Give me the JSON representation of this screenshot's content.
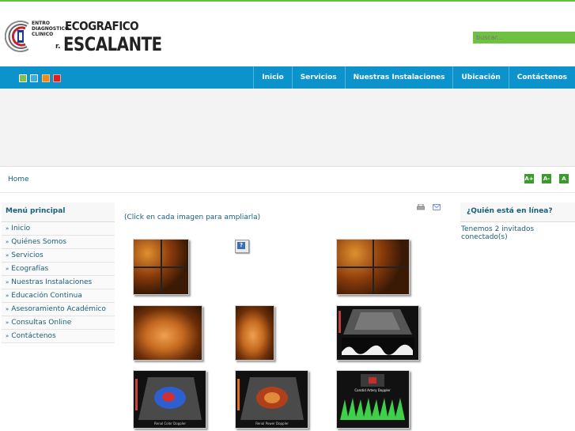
{
  "logo": {
    "small_text": [
      "ENTRO",
      "DIAGNOSTICO",
      "CLINICO"
    ],
    "title_line1": "ECOGRAFICO",
    "title_line2": "ESCALANTE",
    "prefix": "r."
  },
  "search": {
    "placeholder": "buscar..."
  },
  "nav": {
    "swatch_colors": [
      "#7ec242",
      "#3cb0e0",
      "#f08a1c",
      "#d8241c"
    ],
    "items": [
      "Inicio",
      "Servicios",
      "Nuestras Instalaciones",
      "Ubicación",
      "Contáctenos"
    ]
  },
  "breadcrumb": {
    "home": "Home"
  },
  "font_buttons": [
    "A+",
    "A-",
    "A"
  ],
  "left_menu": {
    "title": "Menú principal",
    "items": [
      "Inicio",
      "Quiénes Somos",
      "Servicios",
      "Ecografías",
      "Nuestras Instalaciones",
      "Educación Continua",
      "Asesoramiento Académico",
      "Consultas Online",
      "Contáctenos"
    ]
  },
  "right_box": {
    "title": "¿Quién está en línea?",
    "text": "Tenemos 2 invitados conectado(s)"
  },
  "content": {
    "instruction": "(Click en cada imagen para ampliarla)",
    "help_glyph": "?",
    "us_labels": [
      "Renal Color Doppler",
      "Renal Power Doppler",
      "Carotid Artery Doppler"
    ]
  }
}
